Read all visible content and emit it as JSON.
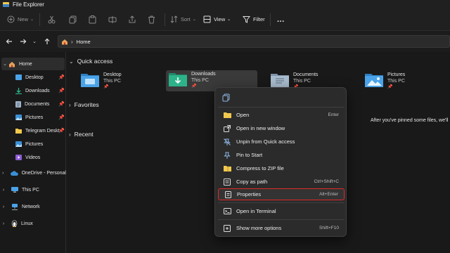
{
  "window": {
    "title": "File Explorer"
  },
  "toolbar": {
    "new_label": "New",
    "sort_label": "Sort",
    "view_label": "View",
    "filter_label": "Filter",
    "more_label": "..."
  },
  "address": {
    "crumb": "Home"
  },
  "sidebar": {
    "home": "Home",
    "quick": [
      {
        "label": "Desktop"
      },
      {
        "label": "Downloads"
      },
      {
        "label": "Documents"
      },
      {
        "label": "Pictures"
      },
      {
        "label": "Telegram Deskt"
      },
      {
        "label": "Pictures"
      },
      {
        "label": "Videos"
      }
    ],
    "onedrive": "OneDrive - Personal",
    "thispc": "This PC",
    "network": "Network",
    "linux": "Linux"
  },
  "content": {
    "quick_access": "Quick access",
    "favorites": "Favorites",
    "recent": "Recent",
    "folders": [
      {
        "name": "Desktop",
        "sub": "This PC"
      },
      {
        "name": "Downloads",
        "sub": "This PC"
      },
      {
        "name": "Documents",
        "sub": "This PC"
      },
      {
        "name": "Pictures",
        "sub": "This PC"
      }
    ],
    "hint": "After you've pinned some files, we'll"
  },
  "context_menu": {
    "items": [
      {
        "label": "Open",
        "shortcut": "Enter"
      },
      {
        "label": "Open in new window",
        "shortcut": ""
      },
      {
        "label": "Unpin from Quick access",
        "shortcut": ""
      },
      {
        "label": "Pin to Start",
        "shortcut": ""
      },
      {
        "label": "Compress to ZIP file",
        "shortcut": ""
      },
      {
        "label": "Copy as path",
        "shortcut": "Ctrl+Shift+C"
      },
      {
        "label": "Properties",
        "shortcut": "Alt+Enter"
      },
      {
        "label": "Open in Terminal",
        "shortcut": ""
      },
      {
        "label": "Show more options",
        "shortcut": "Shift+F10"
      }
    ]
  },
  "colors": {
    "highlight_border": "#e02828",
    "folder_blue": "#4aa3e8",
    "folder_green": "#2db38a",
    "accent": "#f2c94c"
  }
}
